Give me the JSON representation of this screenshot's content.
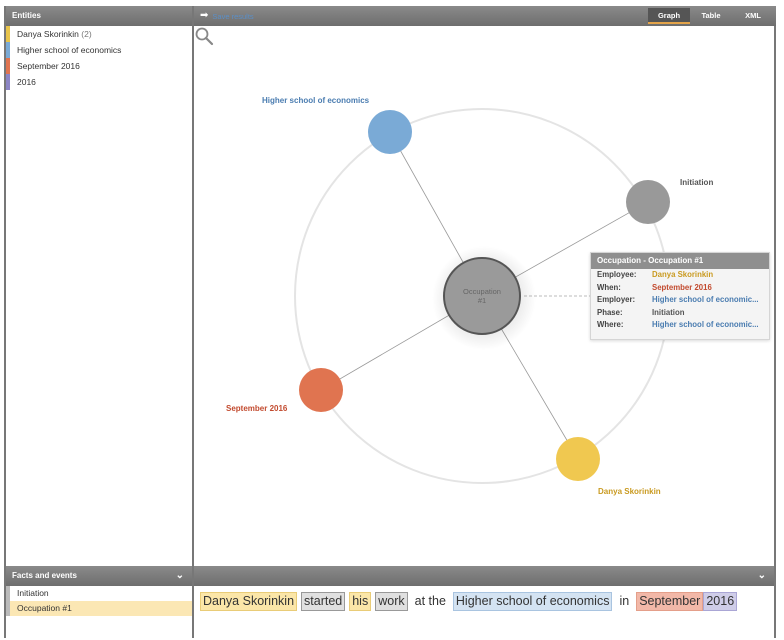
{
  "left_panel": {
    "header": "Entities",
    "entities": [
      {
        "label": "Danya Skorinkin",
        "count": "(2)",
        "color": "#e8c44a"
      },
      {
        "label": "Higher school of economics",
        "count": "",
        "color": "#7aaad6"
      },
      {
        "label": "September 2016",
        "count": "",
        "color": "#e07450"
      },
      {
        "label": "2016",
        "count": "",
        "color": "#8b84c4"
      }
    ]
  },
  "toolbar": {
    "save_label": "Save results",
    "tabs": [
      {
        "label": "Graph",
        "active": true
      },
      {
        "label": "Table",
        "active": false
      },
      {
        "label": "XML",
        "active": false
      }
    ]
  },
  "graph": {
    "center_label": "Occupation #1",
    "nodes": [
      {
        "label": "Higher school of economics",
        "color": "#7aaad6",
        "label_color": "#4a7cb0"
      },
      {
        "label": "Initiation",
        "color": "#999999",
        "label_color": "#555555"
      },
      {
        "label": "September 2016",
        "color": "#e07450",
        "label_color": "#c24a2e"
      },
      {
        "label": "Danya Skorinkin",
        "color": "#f0c850",
        "label_color": "#c99a20"
      }
    ]
  },
  "tooltip": {
    "title": "Occupation - Occupation #1",
    "rows": [
      {
        "key": "Employee:",
        "value": "Danya Skorinkin",
        "color": "#c99a20"
      },
      {
        "key": "When:",
        "value": "September 2016",
        "color": "#c24a2e"
      },
      {
        "key": "Employer:",
        "value": "Higher school of economic...",
        "color": "#4a7cb0"
      },
      {
        "key": "Phase:",
        "value": "Initiation",
        "color": "#555555"
      },
      {
        "key": "Where:",
        "value": "Higher school of economic...",
        "color": "#4a7cb0"
      }
    ]
  },
  "facts_panel": {
    "header": "Facts and events",
    "items": [
      {
        "label": "Initiation",
        "selected": false
      },
      {
        "label": "Occupation #1",
        "selected": true
      }
    ]
  },
  "sentence": {
    "tokens": [
      {
        "text": "Danya Skorinkin",
        "type": "person"
      },
      {
        "text": "started",
        "type": "gray"
      },
      {
        "text": "his",
        "type": "person"
      },
      {
        "text": "work",
        "type": "gray"
      },
      {
        "text": "at the",
        "type": "plain"
      },
      {
        "text": "Higher school of economics",
        "type": "org"
      },
      {
        "text": "in",
        "type": "plain"
      },
      {
        "text": "September",
        "type": "date"
      },
      {
        "text": "2016",
        "type": "year"
      }
    ]
  }
}
